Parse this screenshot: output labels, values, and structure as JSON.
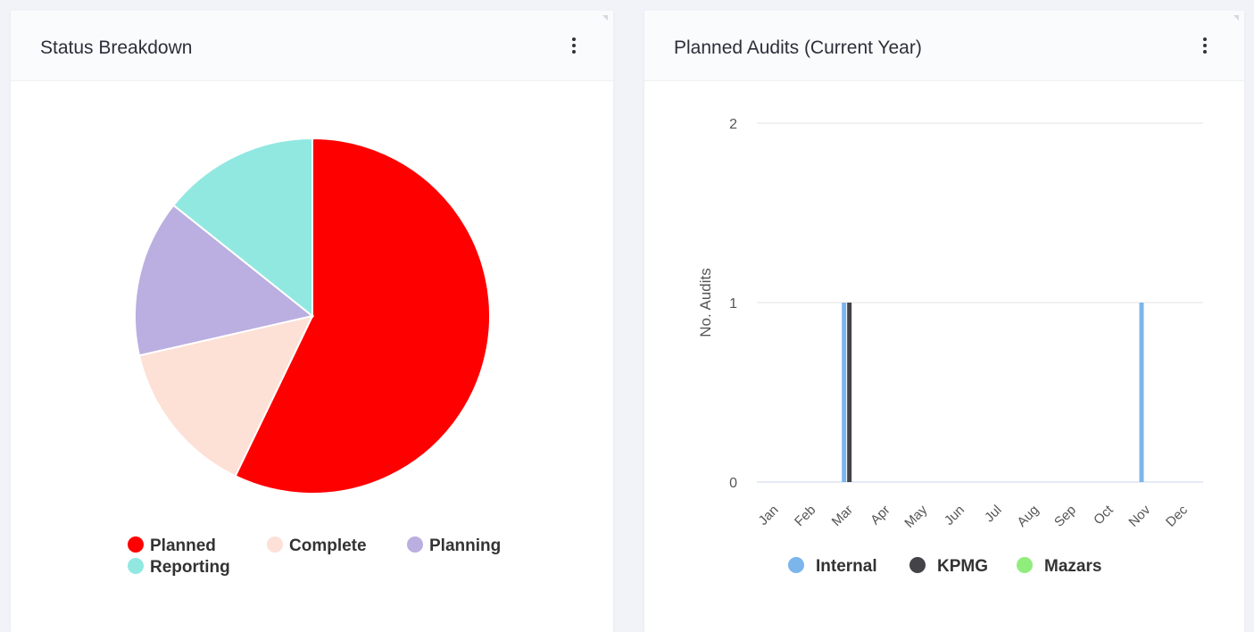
{
  "cards": {
    "left": {
      "title": "Status Breakdown"
    },
    "right": {
      "title": "Planned Audits (Current Year)"
    }
  },
  "colors": {
    "planned": "#ff0000",
    "complete": "#fde0d6",
    "planning": "#bbaee0",
    "reporting": "#91e8e1",
    "internal": "#7cb5ec",
    "kpmg": "#434348",
    "mazars": "#90ed7d",
    "grid": "#e6e6e6",
    "axis_text": "#555555"
  },
  "icons": {
    "menu": "more-vertical-icon"
  },
  "chart_data": [
    {
      "type": "pie",
      "title": "Status Breakdown",
      "slices": [
        {
          "name": "Planned",
          "value": 4
        },
        {
          "name": "Complete",
          "value": 1
        },
        {
          "name": "Planning",
          "value": 1
        },
        {
          "name": "Reporting",
          "value": 1
        }
      ],
      "legend": [
        "Planned",
        "Complete",
        "Planning",
        "Reporting"
      ],
      "legend_position": "bottom"
    },
    {
      "type": "bar",
      "title": "Planned Audits (Current Year)",
      "categories": [
        "Jan",
        "Feb",
        "Mar",
        "Apr",
        "May",
        "Jun",
        "Jul",
        "Aug",
        "Sep",
        "Oct",
        "Nov",
        "Dec"
      ],
      "series": [
        {
          "name": "Internal",
          "values": [
            0,
            0,
            1,
            0,
            0,
            0,
            0,
            0,
            0,
            0,
            1,
            0
          ]
        },
        {
          "name": "KPMG",
          "values": [
            0,
            0,
            1,
            0,
            0,
            0,
            0,
            0,
            0,
            0,
            0,
            0
          ]
        },
        {
          "name": "Mazars",
          "values": [
            0,
            0,
            0,
            0,
            0,
            0,
            0,
            0,
            0,
            0,
            0,
            0
          ]
        }
      ],
      "ylabel": "No. Audits",
      "ylim": [
        0,
        2
      ],
      "yticks": [
        "0",
        "1",
        "2"
      ],
      "grid": true,
      "legend_position": "bottom"
    }
  ]
}
